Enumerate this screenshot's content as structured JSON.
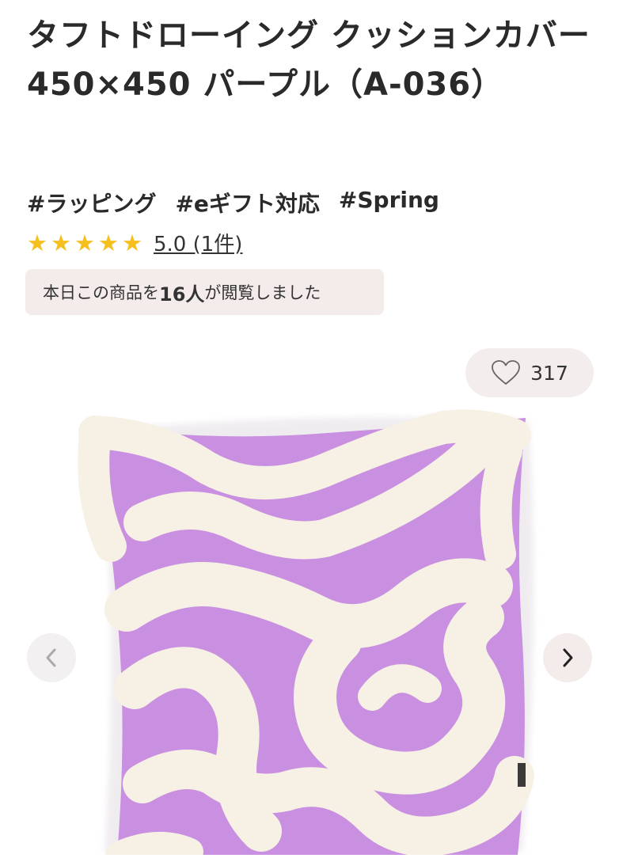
{
  "product": {
    "title": "タフトドローイング クッションカバー 450×450 パープル（A-036）"
  },
  "tags": [
    "#ラッピング",
    "#eギフト対応",
    "#Spring"
  ],
  "rating": {
    "stars": 5,
    "score_text": "5.0 (1件)"
  },
  "viewers": {
    "prefix": "本日この商品を",
    "count": "16人",
    "suffix": "が閲覧しました"
  },
  "favorite": {
    "count": "317",
    "icon": "heart-outline-icon"
  },
  "gallery": {
    "prev_icon": "chevron-left-icon",
    "next_icon": "chevron-right-icon"
  },
  "colors": {
    "star": "#f5bf1f",
    "pillow_purple": "#c98fe0",
    "tuft_cream": "#f6f1e4",
    "chip_background": "#f3ecea"
  }
}
